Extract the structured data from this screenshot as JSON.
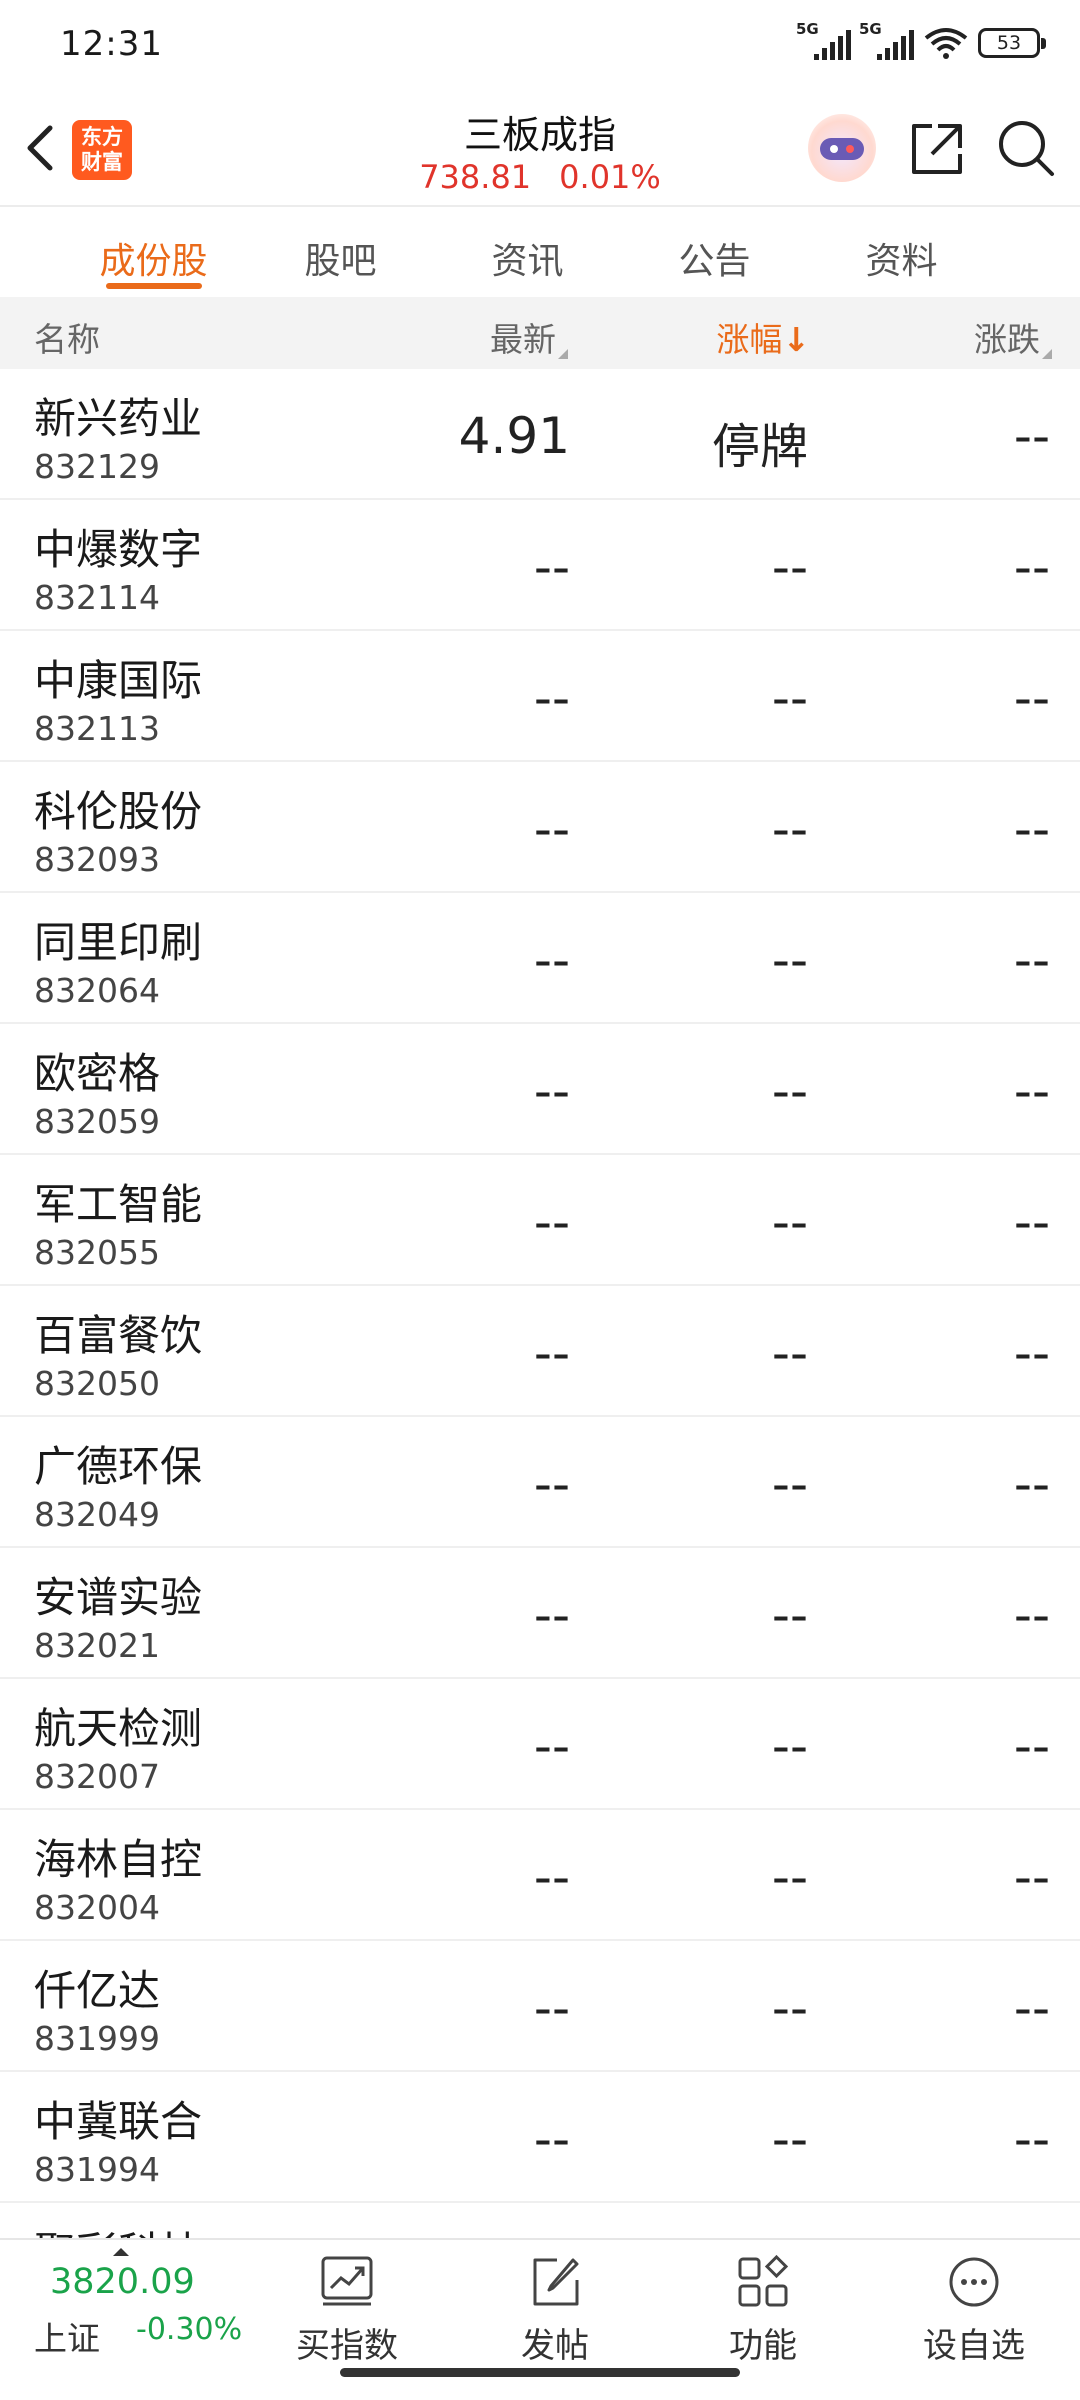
{
  "status": {
    "time": "12:31",
    "network1": "5G",
    "network2": "5G",
    "battery": "53"
  },
  "nav": {
    "logo_line1": "东方",
    "logo_line2": "财富",
    "title": "三板成指",
    "index_value": "738.81",
    "index_change": "0.01%"
  },
  "tabs": [
    {
      "label": "成份股",
      "active": true
    },
    {
      "label": "股吧"
    },
    {
      "label": "资讯"
    },
    {
      "label": "公告"
    },
    {
      "label": "资料"
    }
  ],
  "table": {
    "headers": {
      "name": "名称",
      "last": "最新",
      "change_pct": "涨幅",
      "change": "涨跌"
    },
    "rows": [
      {
        "name": "新兴药业",
        "code": "832129",
        "last": "4.91",
        "change_pct": "停牌",
        "change": "--"
      },
      {
        "name": "中爆数字",
        "code": "832114",
        "last": "--",
        "change_pct": "--",
        "change": "--"
      },
      {
        "name": "中康国际",
        "code": "832113",
        "last": "--",
        "change_pct": "--",
        "change": "--"
      },
      {
        "name": "科伦股份",
        "code": "832093",
        "last": "--",
        "change_pct": "--",
        "change": "--"
      },
      {
        "name": "同里印刷",
        "code": "832064",
        "last": "--",
        "change_pct": "--",
        "change": "--"
      },
      {
        "name": "欧密格",
        "code": "832059",
        "last": "--",
        "change_pct": "--",
        "change": "--"
      },
      {
        "name": "军工智能",
        "code": "832055",
        "last": "--",
        "change_pct": "--",
        "change": "--"
      },
      {
        "name": "百富餐饮",
        "code": "832050",
        "last": "--",
        "change_pct": "--",
        "change": "--"
      },
      {
        "name": "广德环保",
        "code": "832049",
        "last": "--",
        "change_pct": "--",
        "change": "--"
      },
      {
        "name": "安谱实验",
        "code": "832021",
        "last": "--",
        "change_pct": "--",
        "change": "--"
      },
      {
        "name": "航天检测",
        "code": "832007",
        "last": "--",
        "change_pct": "--",
        "change": "--"
      },
      {
        "name": "海林自控",
        "code": "832004",
        "last": "--",
        "change_pct": "--",
        "change": "--"
      },
      {
        "name": "仟亿达",
        "code": "831999",
        "last": "--",
        "change_pct": "--",
        "change": "--"
      },
      {
        "name": "中冀联合",
        "code": "831994",
        "last": "--",
        "change_pct": "--",
        "change": "--"
      },
      {
        "name": "聚彩科技",
        "code": "",
        "last": "",
        "change_pct": "",
        "change": ""
      }
    ]
  },
  "bottom_bar": {
    "index_value": "3820.09",
    "index_name": "上证",
    "index_change": "-0.30%",
    "buttons": [
      {
        "label": "买指数",
        "icon": "chart-trend-icon"
      },
      {
        "label": "发帖",
        "icon": "edit-post-icon"
      },
      {
        "label": "功能",
        "icon": "grid-apps-icon"
      },
      {
        "label": "设自选",
        "icon": "more-dots-icon"
      }
    ]
  },
  "colors": {
    "accent": "#ea6b1a",
    "red": "#e0342b",
    "green": "#1aa34a",
    "logo": "#ff5a1f"
  }
}
